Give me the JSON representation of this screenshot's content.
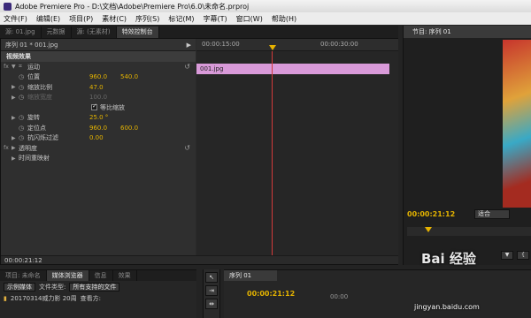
{
  "window": {
    "title": "Adobe Premiere Pro - D:\\文档\\Adobe\\Premiere Pro\\6.0\\未命名.prproj"
  },
  "menubar": [
    "文件(F)",
    "编辑(E)",
    "项目(P)",
    "素材(C)",
    "序列(S)",
    "标记(M)",
    "字幕(T)",
    "窗口(W)",
    "帮助(H)"
  ],
  "source_tabs": [
    "源: 01.jpg",
    "元数据",
    "源: (无素材)",
    "特效控制台"
  ],
  "effect_controls": {
    "sequence_label": "序列 01 * 001.jpg",
    "section": "视频效果",
    "motion": "运动",
    "properties": [
      {
        "label": "位置",
        "v1": "960.0",
        "v2": "540.0"
      },
      {
        "label": "缩放比例",
        "v1": "47.0",
        "v2": ""
      },
      {
        "label": "缩放宽度",
        "v1": "100.0",
        "v2": ""
      },
      {
        "label": "等比缩放",
        "v1": "",
        "v2": ""
      },
      {
        "label": "旋转",
        "v1": "25.0 °",
        "v2": ""
      },
      {
        "label": "定位点",
        "v1": "960.0",
        "v2": "600.0"
      },
      {
        "label": "抗闪烁过滤",
        "v1": "0.00",
        "v2": ""
      }
    ],
    "opacity": "透明度",
    "time_remap": "时间重映射",
    "ruler_start": "00:00:15:00",
    "ruler_end": "00:00:30:00",
    "clip_name": "001.jpg",
    "current_time": "00:00:21:12"
  },
  "program": {
    "tab": "节目: 序列 01",
    "timecode": "00:00:21:12",
    "fit": "适合"
  },
  "project": {
    "tabs": [
      "项目: 未命名",
      "媒体浏览器",
      "信息",
      "效果"
    ],
    "filter_label": "示例媒体",
    "file_type_label": "文件类型:",
    "file_type_value": "所有支持的文件",
    "view_label": "查看方:",
    "folder": "20170314威力影 20周"
  },
  "timeline": {
    "tab": "序列 01",
    "timecode": "00:00:21:12",
    "secondary": "00:00"
  },
  "watermark": {
    "main": "Bai 经验",
    "sub": "jingyan.baidu.com"
  }
}
